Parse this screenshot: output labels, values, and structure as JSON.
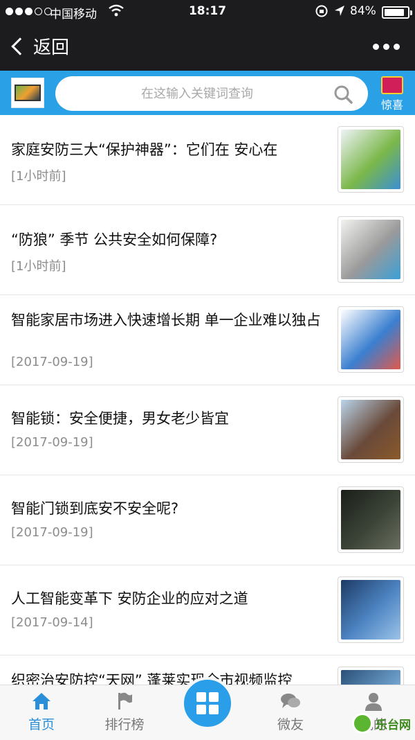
{
  "status_bar": {
    "carrier": "中国移动",
    "time": "18:17",
    "battery": "84%"
  },
  "nav": {
    "back_label": "返回"
  },
  "search": {
    "placeholder": "在这输入关键词查询",
    "surprise_label": "惊喜"
  },
  "articles": [
    {
      "title": "家庭安防三大“保护神器”：它们在 安心在",
      "time": "[1小时前]",
      "thumb_colors": [
        "#eef3f7",
        "#7bb84a",
        "#3b8fd3"
      ]
    },
    {
      "title": "“防狼” 季节 公共安全如何保障?",
      "time": "[1小时前]",
      "thumb_colors": [
        "#f2f2ef",
        "#9a9a9a",
        "#3aa0d8"
      ]
    },
    {
      "title": "智能家居市场进入快速增长期 单一企业难以独占",
      "time": "[2017-09-19]",
      "thumb_colors": [
        "#ffffff",
        "#3b7fd0",
        "#e05a4a"
      ]
    },
    {
      "title": "智能锁：安全便捷，男女老少皆宜",
      "time": "[2017-09-19]",
      "thumb_colors": [
        "#b9d4ea",
        "#6a4a3a",
        "#8a5a2a"
      ]
    },
    {
      "title": "智能门锁到底安不安全呢?",
      "time": "[2017-09-19]",
      "thumb_colors": [
        "#1a1e18",
        "#3c4438",
        "#6a7060"
      ]
    },
    {
      "title": "人工智能变革下 安防企业的应对之道",
      "time": "[2017-09-14]",
      "thumb_colors": [
        "#1d3b66",
        "#4f86c4",
        "#9cc3e8"
      ]
    },
    {
      "title": "织密治安防控“天网” 蓬莱实现全市视频监控",
      "time": "",
      "thumb_colors": [
        "#2a5078",
        "#6a9cc8",
        "#c8dcee"
      ]
    }
  ],
  "tabbar": {
    "items": [
      {
        "label": "首页",
        "icon": "home-icon"
      },
      {
        "label": "排行榜",
        "icon": "flag-icon"
      },
      {
        "label": "微友",
        "icon": "chat-icon"
      },
      {
        "label": "我的",
        "icon": "user-icon"
      }
    ],
    "watermark": "乐台网",
    "active_color": "#2a8fd8",
    "inactive_color": "#777777"
  }
}
